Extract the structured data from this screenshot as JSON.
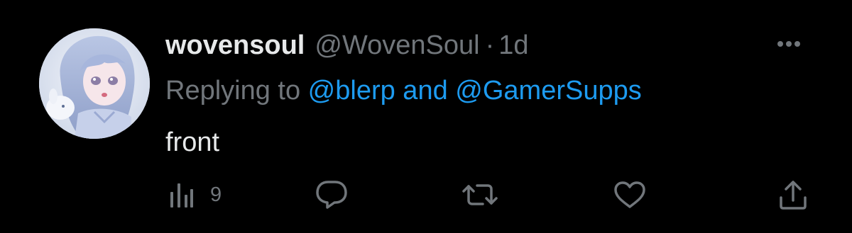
{
  "tweet": {
    "display_name": "wovensoul",
    "handle": "@WovenSoul",
    "separator": "·",
    "time": "1d",
    "replying_prefix": "Replying to ",
    "mention_1": "@blerp",
    "reply_conjunction": " and ",
    "mention_2": "@GamerSupps",
    "text": "front"
  },
  "actions": {
    "views_count": "9"
  },
  "icons": {
    "more": "more-dots-icon",
    "views": "views-bar-chart-icon",
    "reply": "reply-bubble-icon",
    "retweet": "retweet-icon",
    "like": "heart-icon",
    "share": "share-upload-icon"
  },
  "colors": {
    "background": "#000000",
    "primary_text": "#e7e9ea",
    "secondary_text": "#71767b",
    "link": "#1d9bf0"
  }
}
